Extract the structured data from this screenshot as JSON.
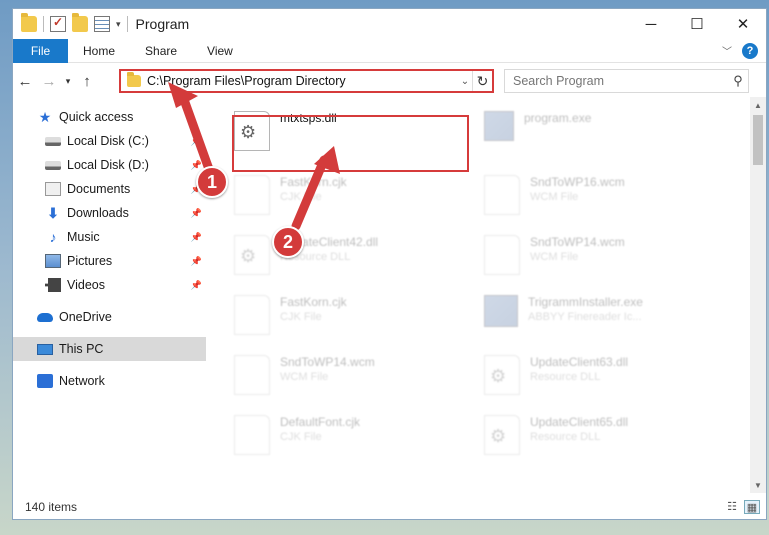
{
  "window": {
    "title": "Program",
    "controls": {
      "minimize": "─",
      "maximize": "☐",
      "close": "✕"
    }
  },
  "ribbon": {
    "tabs": [
      "File",
      "Home",
      "Share",
      "View"
    ],
    "help": "?"
  },
  "address": {
    "path": "C:\\Program Files\\Program Directory"
  },
  "search": {
    "placeholder": "Search Program"
  },
  "sidebar": {
    "items": [
      {
        "label": "Quick access",
        "icon": "star-icon"
      },
      {
        "label": "Local Disk (C:)",
        "icon": "disk-icon"
      },
      {
        "label": "Local Disk (D:)",
        "icon": "disk-icon"
      },
      {
        "label": "Documents",
        "icon": "documents-icon"
      },
      {
        "label": "Downloads",
        "icon": "downloads-icon"
      },
      {
        "label": "Music",
        "icon": "music-icon"
      },
      {
        "label": "Pictures",
        "icon": "pictures-icon"
      },
      {
        "label": "Videos",
        "icon": "videos-icon"
      },
      {
        "label": "OneDrive",
        "icon": "cloud-icon"
      },
      {
        "label": "This PC",
        "icon": "computer-icon"
      },
      {
        "label": "Network",
        "icon": "network-icon"
      }
    ]
  },
  "files": [
    {
      "name": "mtxtsps.dll",
      "type": ""
    },
    {
      "name": "program.exe",
      "type": ""
    },
    {
      "name": "FastKorn.cjk",
      "type": "CJK File"
    },
    {
      "name": "SndToWP16.wcm",
      "type": "WCM File"
    },
    {
      "name": "UpdateClient42.dll",
      "type": "Resource DLL"
    },
    {
      "name": "SndToWP14.wcm",
      "type": "WCM File"
    },
    {
      "name": "FastKorn.cjk",
      "type": "CJK File"
    },
    {
      "name": "TrigrammInstaller.exe",
      "type": "ABBYY Finereader Ic..."
    },
    {
      "name": "SndToWP14.wcm",
      "type": "WCM File"
    },
    {
      "name": "UpdateClient63.dll",
      "type": "Resource DLL"
    },
    {
      "name": "DefaultFont.cjk",
      "type": "CJK File"
    },
    {
      "name": "UpdateClient65.dll",
      "type": "Resource DLL"
    }
  ],
  "status": {
    "count": "140 items"
  },
  "annotations": {
    "step1": "1",
    "step2": "2"
  },
  "colors": {
    "accent": "#1979ca",
    "highlight": "#d63b3b"
  }
}
